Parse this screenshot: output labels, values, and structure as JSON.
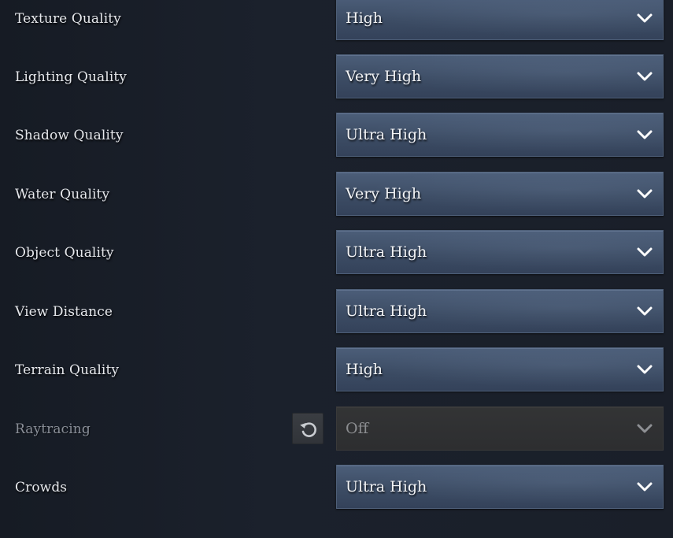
{
  "settings": [
    {
      "label": "Texture Quality",
      "value": "High",
      "disabled": false
    },
    {
      "label": "Lighting Quality",
      "value": "Very High",
      "disabled": false
    },
    {
      "label": "Shadow Quality",
      "value": "Ultra High",
      "disabled": false
    },
    {
      "label": "Water Quality",
      "value": "Very High",
      "disabled": false
    },
    {
      "label": "Object Quality",
      "value": "Ultra High",
      "disabled": false
    },
    {
      "label": "View Distance",
      "value": "Ultra High",
      "disabled": false
    },
    {
      "label": "Terrain Quality",
      "value": "High",
      "disabled": false
    },
    {
      "label": "Raytracing",
      "value": "Off",
      "disabled": true
    },
    {
      "label": "Crowds",
      "value": "Ultra High",
      "disabled": false
    }
  ],
  "icons": {
    "dropdown": "chevron-down-icon",
    "reset": "reset-icon"
  },
  "colors": {
    "dropdown_bg": "#3f4f68",
    "dropdown_border": "#4e5f78",
    "disabled_bg": "#303133",
    "label_text": "#e6e8ec",
    "disabled_text": "#8a8f98"
  }
}
